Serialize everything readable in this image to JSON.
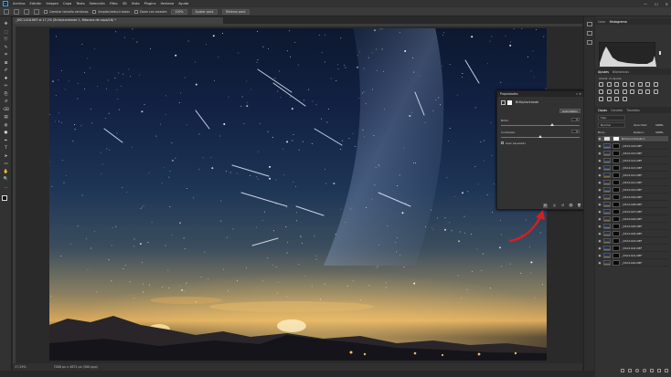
{
  "menubar": {
    "logo": "Ps",
    "items": [
      "Archivo",
      "Edición",
      "Imagen",
      "Capa",
      "Texto",
      "Selección",
      "Filtro",
      "3D",
      "Vista",
      "Plugins",
      "Ventana",
      "Ayuda"
    ],
    "window_controls": [
      "—",
      "☐",
      "✕"
    ]
  },
  "optbar": {
    "resize_all_windows": "Cambiar tamaño ventanas",
    "zoom_all_windows": "Ampliar/reducir todas",
    "scrubby_zoom": "Zoom con arrastre",
    "zoom_level": "100%",
    "fit_screen": "Ajustar pant.",
    "fill_screen": "Rellenar pant."
  },
  "document": {
    "tab_title": "_DSC1416.NEF al 17,2% (Brillo/contraste 1, Máscara de capa/16) *",
    "zoom": "17,29%",
    "doc_info": "7008 px x 4672 px (300 ppp)"
  },
  "toolbar": {
    "tools": [
      "move-tool",
      "marquee-tool",
      "lasso-tool",
      "quick-select-tool",
      "crop-tool",
      "frame-tool",
      "eyedropper-tool",
      "spot-heal-tool",
      "brush-tool",
      "clone-stamp-tool",
      "history-brush-tool",
      "eraser-tool",
      "gradient-tool",
      "blur-tool",
      "dodge-tool",
      "pen-tool",
      "type-tool",
      "path-select-tool",
      "rectangle-tool",
      "hand-tool",
      "zoom-tool",
      "more-tools"
    ],
    "glyphs": [
      "✥",
      "⬚",
      "➰",
      "✎",
      "⌗",
      "⊠",
      "✐",
      "✚",
      "✏",
      "⎘",
      "↺",
      "⌫",
      "▤",
      "◍",
      "●",
      "✒",
      "T",
      "➤",
      "▭",
      "✋",
      "🔍",
      "…"
    ]
  },
  "panels": {
    "top_tabs": [
      "Color",
      "Histograma"
    ],
    "top_active": "Histograma",
    "adjust_tabs": [
      "Ajustes",
      "Bibliotecas"
    ],
    "adjust_subtitle": "Añadir un ajuste",
    "layers_tabs": [
      "Capas",
      "Canales",
      "Trazados"
    ],
    "layers_kind": "Tipo",
    "blend_mode": "Normal",
    "opacity_label": "Opacidad:",
    "opacity_value": "100%",
    "lock_label": "Bloq.:",
    "fill_label": "Relleno:",
    "fill_value": "100%",
    "layers": [
      "Brillo/contraste 1",
      "_DSC1416.NEF",
      "_DSC1415.NEF",
      "_DSC1414.NEF",
      "_DSC1413.NEF",
      "_DSC1412.NEF",
      "_DSC1411.NEF",
      "_DSC1410.NEF",
      "_DSC1409.NEF",
      "_DSC1408.NEF",
      "_DSC1407.NEF",
      "_DSC1406.NEF",
      "_DSC1405.NEF",
      "_DSC1404.NEF",
      "_DSC1403.NEF",
      "_DSC1402.NEF",
      "_DSC1401.NEF",
      "_DSC1400.NEF"
    ],
    "layers_footer_icons": [
      "link-icon",
      "fx-icon",
      "mask-icon",
      "adjustment-icon",
      "folder-icon",
      "new-layer-icon",
      "trash-icon"
    ]
  },
  "properties": {
    "title": "Propiedades",
    "close": "«  ✕",
    "subtitle": "Brillo/contraste",
    "auto_button": "Automático",
    "brightness_label": "Brillo:",
    "brightness_value": "0",
    "contrast_label": "Contraste:",
    "contrast_value": "0",
    "legacy_label": "Usar heredado",
    "footer_icons": [
      "clip-to-layer-icon",
      "view-previous-icon",
      "reset-icon",
      "visibility-icon",
      "delete-icon"
    ],
    "footer_glyphs": [
      "⊡",
      "◎",
      "↺",
      "👁",
      "🗑"
    ]
  },
  "colors": {
    "accent": "#31a8ff",
    "annotation_arrow": "#d61f1f",
    "panel_bg": "#323232",
    "app_bg": "#282828"
  }
}
